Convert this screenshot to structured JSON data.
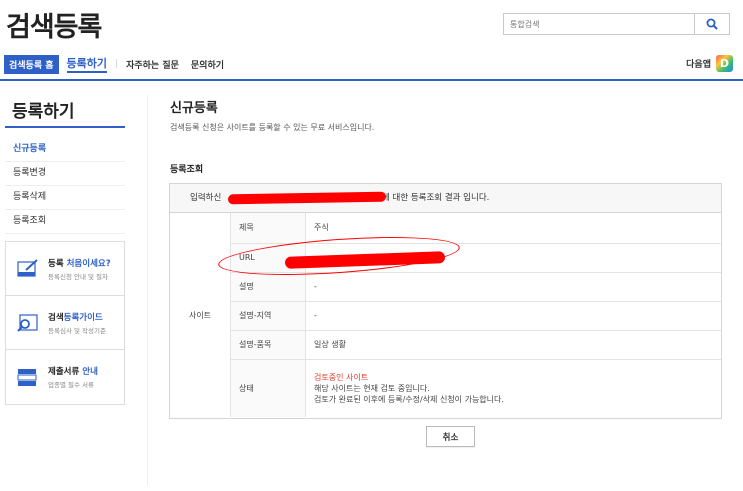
{
  "header": {
    "logo": "검색등록",
    "search_placeholder": "통합검색",
    "daum_label": "다음앱",
    "daum_icon_letter": "D"
  },
  "nav": {
    "home": "검색등록 홈",
    "active": "등록하기",
    "items": [
      "자주하는 질문",
      "문의하기"
    ]
  },
  "sidebar": {
    "title": "등록하기",
    "items": [
      "신규등록",
      "등록변경",
      "등록삭제",
      "등록조회"
    ],
    "guides": [
      {
        "pre": "등록 ",
        "bold": "처음이세요?",
        "post": "",
        "sub": "등록신청 안내 및 절차"
      },
      {
        "pre": "검색",
        "bold": "등록가이드",
        "post": "",
        "sub": "등록심사 및 작성기준"
      },
      {
        "pre": "제출서류 ",
        "bold": "안내",
        "post": "",
        "sub": "업종별 필수 서류"
      }
    ]
  },
  "main": {
    "title": "신규등록",
    "description": "검색등록 신청은 사이트를 등록할 수 있는 무료 서비스입니다.",
    "section": "등록조회",
    "message_prefix": "입력하신 ",
    "message_suffix": "에 대한 등록조회 결과 입니다.",
    "site_label": "사이트",
    "rows": [
      {
        "label": "제목",
        "value": "주식"
      },
      {
        "label": "URL",
        "value": ""
      },
      {
        "label": "설명",
        "value": "-"
      },
      {
        "label": "설명-지역",
        "value": "-"
      },
      {
        "label": "설명-품목",
        "value": "일상 생활"
      }
    ],
    "status_label": "상태",
    "status_title": "검토중인 사이트",
    "status_line1": "해당 사이트는 현재 검토 중입니다.",
    "status_line2": "검토가 완료된 이후에 등록/수정/삭제 신청이 가능합니다.",
    "cancel": "취소"
  },
  "colors": {
    "accent": "#2e60c8",
    "status_red": "#e03b2b"
  }
}
